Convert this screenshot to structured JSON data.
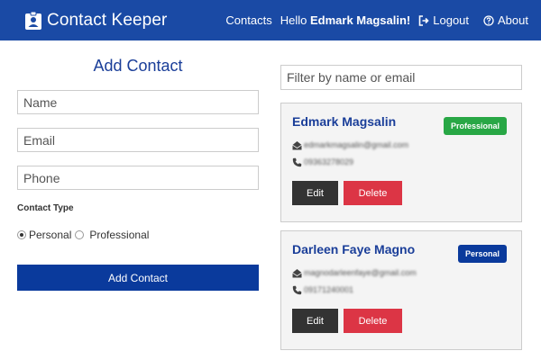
{
  "colors": {
    "navbar": "#1a4aa5",
    "title": "#1a3e99",
    "primary_button": "#0a3a9c",
    "professional_badge": "#28a745",
    "personal_badge": "#0a3a9c",
    "edit_button": "#333333",
    "delete_button": "#dc3545",
    "card_background": "#f4f4f4"
  },
  "navbar": {
    "app_icon": "id-badge-icon",
    "title": "Contact Keeper",
    "contacts_link": "Contacts",
    "hello_prefix": "Hello",
    "user_name": "Edmark Magsalin!",
    "logout": {
      "icon": "sign-out-icon",
      "label": "Logout"
    },
    "about": {
      "icon": "question-circle-icon",
      "label": "About"
    }
  },
  "form": {
    "title": "Add Contact",
    "name_placeholder": "Name",
    "email_placeholder": "Email",
    "phone_placeholder": "Phone",
    "type_label": "Contact Type",
    "options": [
      {
        "label": "Personal",
        "checked": true
      },
      {
        "label": "Professional",
        "checked": false
      }
    ],
    "submit_label": "Add Contact"
  },
  "filter": {
    "placeholder": "Filter by name or email"
  },
  "contacts": [
    {
      "name": "Edmark Magsalin",
      "type": "Professional",
      "email": "edmarkmagsalin@gmail.com",
      "phone": "09363278029",
      "email_icon": "envelope-open-icon",
      "phone_icon": "phone-icon",
      "edit_label": "Edit",
      "delete_label": "Delete"
    },
    {
      "name": "Darleen Faye Magno",
      "type": "Personal",
      "email": "magnodarleenfaye@gmail.com",
      "phone": "09171240001",
      "email_icon": "envelope-open-icon",
      "phone_icon": "phone-icon",
      "edit_label": "Edit",
      "delete_label": "Delete"
    }
  ]
}
